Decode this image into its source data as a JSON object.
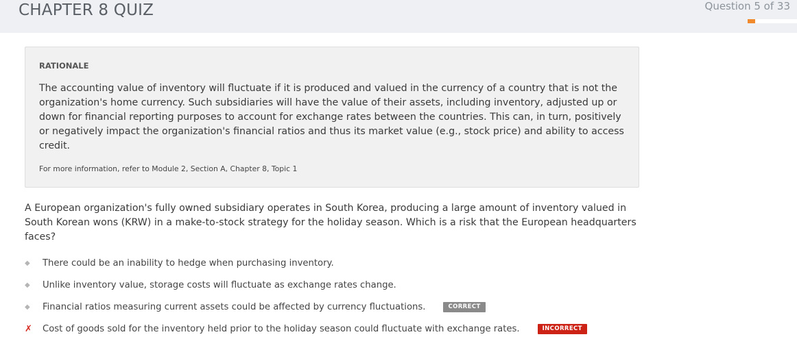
{
  "header": {
    "title": "CHAPTER 8 QUIZ",
    "counter": "Question 5 of 33",
    "progress": {
      "current": 5,
      "total": 33
    }
  },
  "rationale": {
    "heading": "RATIONALE",
    "body": "The accounting value of inventory will fluctuate if it is produced and valued in the currency of a country that is not the organization's home currency. Such subsidiaries will have the value of their assets, including inventory, adjusted up or down for financial reporting purposes to account for exchange rates between the countries. This can, in turn, positively or negatively impact the organization's financial ratios and thus its market value (e.g., stock price) and ability to access credit.",
    "reference": "For more information, refer to Module 2, Section A, Chapter 8, Topic 1"
  },
  "question": {
    "text": "A European organization's fully owned subsidiary operates in South Korea, producing a large amount of inventory valued in South Korean wons (KRW) in a make-to-stock strategy for the holiday season. Which is a risk that the European headquarters faces?"
  },
  "options": [
    {
      "marker": "◆",
      "text": "There could be an inability to hedge when purchasing inventory.",
      "badge": ""
    },
    {
      "marker": "◆",
      "text": "Unlike inventory value, storage costs will fluctuate as exchange rates change.",
      "badge": ""
    },
    {
      "marker": "◆",
      "text": "Financial ratios measuring current assets could be affected by currency fluctuations.",
      "badge": "CORRECT"
    },
    {
      "marker": "✗",
      "text": "Cost of goods sold for the inventory held prior to the holiday season could fluctuate with exchange rates.",
      "badge": "INCORRECT"
    }
  ],
  "colors": {
    "progress": "#f08a2c",
    "correct_badge": "#8a8a8a",
    "incorrect_badge": "#cc2316",
    "wrong_mark": "#d62a1e"
  }
}
